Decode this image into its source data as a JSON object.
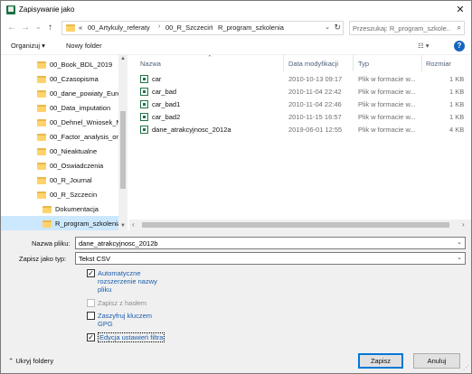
{
  "window": {
    "title": "Zapisywanie jako",
    "close_label": "✕"
  },
  "nav": {
    "back": "←",
    "forward": "→",
    "dropdown": "⌄",
    "up": "↑",
    "breadcrumb": [
      "«",
      "00_Artykuly_referaty",
      "00_R_Szczecin",
      "R_program_szkolenia"
    ],
    "search_placeholder": "Przeszukaj: R_program_szkole...",
    "refresh": "↻"
  },
  "toolbar": {
    "organize_label": "Organizuj ▾",
    "new_folder_label": "Nowy folder",
    "view_label": "☷ ▾",
    "help_label": "?"
  },
  "tree": {
    "items": [
      {
        "label": "00_Book_BDL_2019",
        "indent": 1
      },
      {
        "label": "00_Czasopisma",
        "indent": 1
      },
      {
        "label": "00_dane_powiaty_Euro",
        "indent": 1
      },
      {
        "label": "00_Data_imputation",
        "indent": 1
      },
      {
        "label": "00_Dehnel_Wniosek_N",
        "indent": 1
      },
      {
        "label": "00_Factor_analysis_ord",
        "indent": 1
      },
      {
        "label": "00_Nieaktualne",
        "indent": 1
      },
      {
        "label": "00_Oswiadczenia",
        "indent": 1
      },
      {
        "label": "00_R_Journal",
        "indent": 1
      },
      {
        "label": "00_R_Szczecin",
        "indent": 1
      },
      {
        "label": "Dokumentacja",
        "indent": 2
      },
      {
        "label": "R_program_szkolenia",
        "indent": 2,
        "selected": true
      },
      {
        "label": "Zalozenie_30-05-201",
        "indent": 2
      }
    ]
  },
  "files": {
    "columns": {
      "name": "Nazwa",
      "date": "Data modyfikacji",
      "type": "Typ",
      "size": "Rozmiar"
    },
    "rows": [
      {
        "name": "car",
        "date": "2010-10-13 09:17",
        "type": "Plik w formacie w...",
        "size": "1 KB"
      },
      {
        "name": "car_bad",
        "date": "2010-11-04 22:42",
        "type": "Plik w formacie w...",
        "size": "1 KB"
      },
      {
        "name": "car_bad1",
        "date": "2010-11-04 22:46",
        "type": "Plik w formacie w...",
        "size": "1 KB"
      },
      {
        "name": "car_bad2",
        "date": "2010-11-15 16:57",
        "type": "Plik w formacie w...",
        "size": "1 KB"
      },
      {
        "name": "dane_atrakcyjnosc_2012a",
        "date": "2019-06-01 12:55",
        "type": "Plik w formacie w...",
        "size": "4 KB"
      }
    ]
  },
  "form": {
    "filename_label": "Nazwa pliku:",
    "filename_value": "dane_atrakcyjnosc_2012b",
    "filetype_label": "Zapisz jako typ:",
    "filetype_value": "Tekst CSV",
    "options": [
      {
        "label": "Automatyczne rozszerzenie nazwy pliku",
        "checked": true,
        "disabled": false
      },
      {
        "label": "Zapisz z hasłem",
        "checked": false,
        "disabled": true
      },
      {
        "label": "Zaszyfruj kluczem GPG",
        "checked": false,
        "disabled": false
      },
      {
        "label": "Edycja ustawień filtra",
        "checked": true,
        "disabled": false
      }
    ]
  },
  "footer": {
    "hide_folders_label": "Ukryj foldery",
    "save_label": "Zapisz",
    "cancel_label": "Anuluj"
  },
  "colors": {
    "accent": "#0078d7",
    "selection": "#cce8ff",
    "folder": "#ffd36b",
    "link_text": "#1a5dab"
  }
}
